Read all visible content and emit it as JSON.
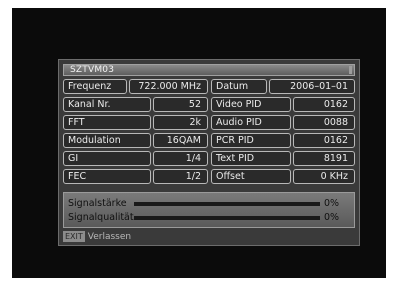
{
  "window": {
    "title": "SZTVM03"
  },
  "rows": [
    {
      "label1": "Frequenz",
      "value1": "722.000 MHz",
      "label2": "Datum",
      "value2": "2006–01–01"
    },
    {
      "label1": "Kanal Nr.",
      "value1": "52",
      "label2": "Video PID",
      "value2": "0162"
    },
    {
      "label1": "FFT",
      "value1": "2k",
      "label2": "Audio PID",
      "value2": "0088"
    },
    {
      "label1": "Modulation",
      "value1": "16QAM",
      "label2": "PCR PID",
      "value2": "0162"
    },
    {
      "label1": "GI",
      "value1": "1/4",
      "label2": "Text PID",
      "value2": "8191"
    },
    {
      "label1": "FEC",
      "value1": "1/2",
      "label2": "Offset",
      "value2": "0 KHz"
    }
  ],
  "signal": {
    "strength_label": "Signalstärke",
    "strength_value": "0%",
    "strength_level": 0,
    "quality_label": "Signalqualität",
    "quality_value": "0%",
    "quality_level": 0
  },
  "footer": {
    "key": "EXIT",
    "label": "Verlassen"
  },
  "colors": {
    "panel_bg": "#3a3a3a",
    "cell_border": "#b8b8b8",
    "text": "#ececec"
  }
}
